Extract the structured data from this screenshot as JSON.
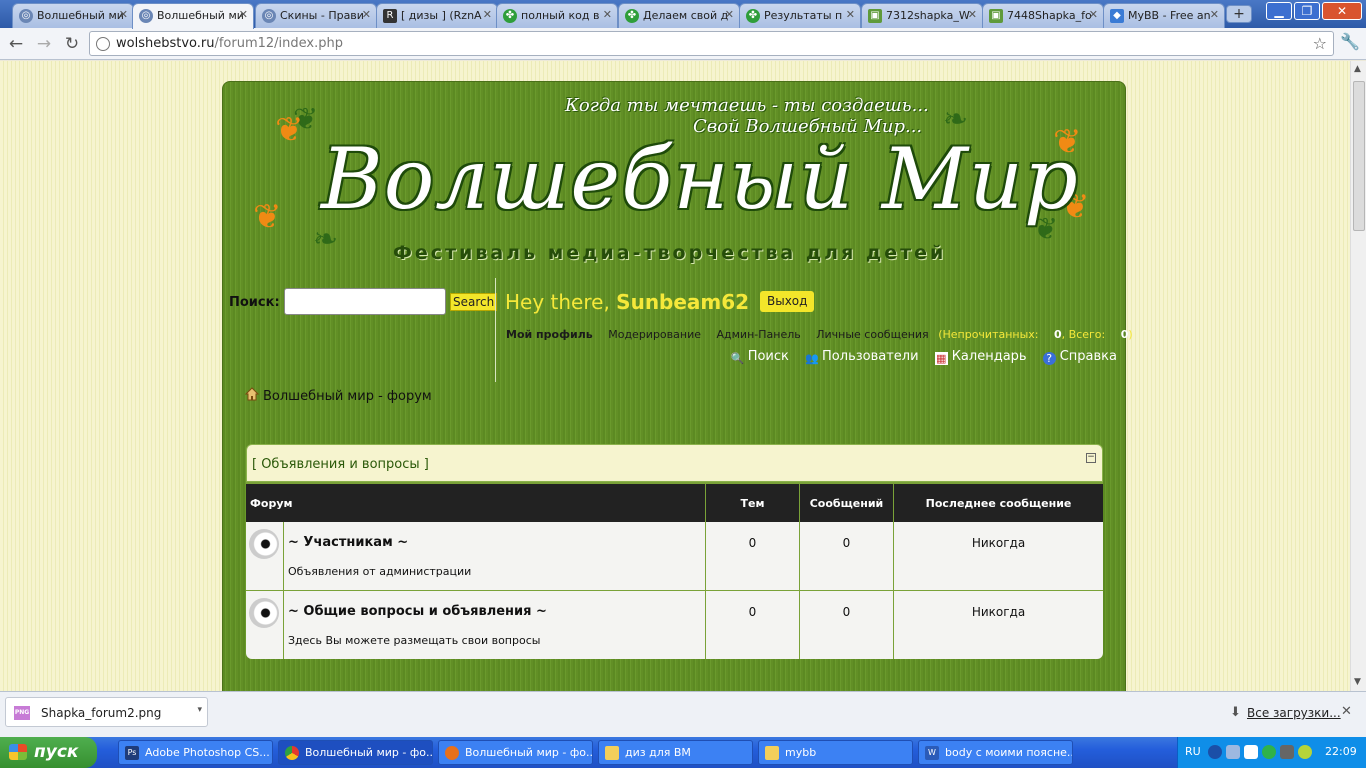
{
  "browser": {
    "tabs": [
      {
        "title": "Волшебный ми",
        "icon": "globe-icon"
      },
      {
        "title": "Волшебный ми",
        "icon": "globe-icon",
        "active": true
      },
      {
        "title": "Скины - Прави",
        "icon": "globe-icon"
      },
      {
        "title": "[ дизы ] (RznA",
        "icon": "r-site-icon"
      },
      {
        "title": "полный код в",
        "icon": "clover-icon"
      },
      {
        "title": "Делаем свой д",
        "icon": "clover-icon"
      },
      {
        "title": "Результаты п",
        "icon": "clover-icon"
      },
      {
        "title": "7312shapka_W",
        "icon": "image-icon"
      },
      {
        "title": "7448Shapka_fo",
        "icon": "image-icon"
      },
      {
        "title": "MyBB - Free an",
        "icon": "mybb-icon"
      }
    ],
    "url_domain": "wolshebstvo.ru",
    "url_path": "/forum12/index.php"
  },
  "header": {
    "tagline_1": "Когда ты мечтаешь - ты создаешь...",
    "tagline_2": "Свой Волшебный Мир...",
    "title": "Волшебный Мир",
    "subtitle": "Фестиваль медиа-творчества для детей"
  },
  "search": {
    "label": "Поиск:",
    "button": "Search",
    "value": ""
  },
  "user": {
    "greeting": "Hey there,",
    "username": "Sunbeam62",
    "logout": "Выход",
    "links": {
      "profile": "Мой профиль",
      "moderation": "Модерирование",
      "admin": "Админ-Панель",
      "pm": "Личные сообщения",
      "pm_count_prefix": "(Непрочитанных: ",
      "unread": "0",
      "pm_count_mid": ", Всего: ",
      "total": "0",
      "pm_count_suffix": ")"
    }
  },
  "menu": {
    "search": "Поиск",
    "members": "Пользователи",
    "calendar": "Календарь",
    "help": "Справка"
  },
  "breadcrumb": "Волшебный мир - форум",
  "forum": {
    "category": "[ Объявления и вопросы ]",
    "columns": [
      "Форум",
      "Тем",
      "Сообщений",
      "Последнее сообщение"
    ],
    "rows": [
      {
        "name": "~ Участникам ~",
        "description": "Объявления от администрации",
        "threads": "0",
        "posts": "0",
        "last": "Никогда"
      },
      {
        "name": "~ Общие вопросы и объявления ~",
        "description": "Здесь Вы можете размещать свои вопросы",
        "threads": "0",
        "posts": "0",
        "last": "Никогда"
      }
    ]
  },
  "downloads": {
    "file": "Shapka_forum2.png",
    "all_label": "Все загрузки..."
  },
  "taskbar": {
    "start": "пуск",
    "tasks": [
      {
        "label": "Adobe Photoshop CS...",
        "icon": "photoshop-icon"
      },
      {
        "label": "Волшебный мир - фо...",
        "icon": "chrome-icon",
        "active": true
      },
      {
        "label": "Волшебный мир - фо...",
        "icon": "firefox-icon"
      },
      {
        "label": "диз для ВМ",
        "icon": "folder-icon"
      },
      {
        "label": "mybb",
        "icon": "folder-icon"
      },
      {
        "label": "body с моими поясне...",
        "icon": "word-icon"
      }
    ],
    "lang": "RU",
    "time": "22:09"
  },
  "colors": {
    "forum_green": "#628f26",
    "accent_yellow": "#f5e83a",
    "page_cream": "#f6f4cf"
  }
}
